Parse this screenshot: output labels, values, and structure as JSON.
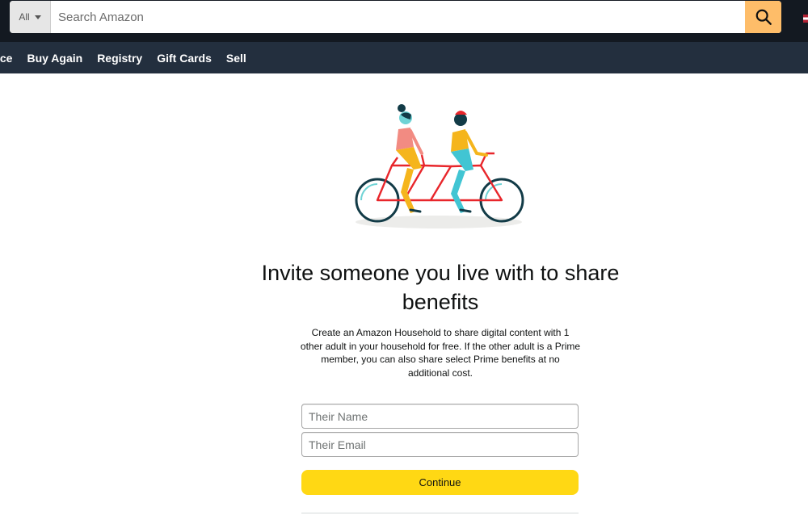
{
  "header": {
    "search": {
      "category": "All",
      "placeholder": "Search Amazon",
      "icon": "search-icon"
    },
    "nav": {
      "items": [
        "ice",
        "Buy Again",
        "Registry",
        "Gift Cards",
        "Sell"
      ]
    }
  },
  "main": {
    "illustration": "tandem-bicycle-illustration",
    "title": "Invite someone you live with to share benefits",
    "description": "Create an Amazon Household to share digital content with 1 other adult in your household for free. If the other adult is a Prime member, you can also share select Prime benefits at no additional cost.",
    "form": {
      "name_placeholder": "Their Name",
      "email_placeholder": "Their Email",
      "continue_label": "Continue"
    }
  },
  "colors": {
    "header_bg": "#131921",
    "nav_bg": "#232f3e",
    "search_button": "#febd69",
    "continue_button": "#ffd814"
  }
}
